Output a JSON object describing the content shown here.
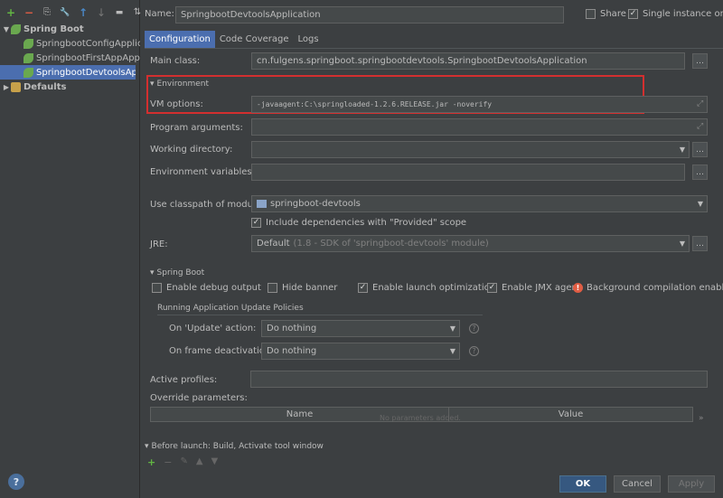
{
  "left_toolbar": {
    "icons": [
      "+",
      "−",
      "⎘",
      "🔧",
      "↑",
      "↓",
      "▬",
      "⇅"
    ]
  },
  "tree": {
    "group_spring_boot": "Spring Boot",
    "items": [
      "SpringbootConfigApplic",
      "SpringbootFirstAppAppl",
      "SpringbootDevtoolsApp"
    ],
    "group_defaults": "Defaults"
  },
  "header": {
    "name_label": "Name:",
    "name_value": "SpringbootDevtoolsApplication",
    "share_label": "Share",
    "single_instance_label": "Single instance only"
  },
  "tabs": [
    "Configuration",
    "Code Coverage",
    "Logs"
  ],
  "form": {
    "main_class_label": "Main class:",
    "main_class_value": "cn.fulgens.springboot.springbootdevtools.SpringbootDevtoolsApplication",
    "environment_section": "Environment",
    "vm_options_label": "VM options:",
    "vm_options_value": "-javaagent:C:\\springloaded-1.2.6.RELEASE.jar -noverify",
    "program_args_label": "Program arguments:",
    "working_dir_label": "Working directory:",
    "env_vars_label": "Environment variables:",
    "classpath_label": "Use classpath of module:",
    "classpath_value": "springboot-devtools",
    "include_deps_label": "Include dependencies with \"Provided\" scope",
    "jre_label": "JRE:",
    "jre_value": "Default",
    "jre_detail": "(1.8 - SDK of 'springboot-devtools' module)"
  },
  "spring_boot": {
    "section": "Spring Boot",
    "debug_output": "Enable debug output",
    "hide_banner": "Hide banner",
    "launch_opt": "Enable launch optimization",
    "jmx_agent": "Enable JMX agent",
    "bg_compilation": "Background compilation enabled",
    "policies_title": "Running Application Update Policies",
    "on_update_label": "On 'Update' action:",
    "on_update_value": "Do nothing",
    "on_frame_label": "On frame deactivation:",
    "on_frame_value": "Do nothing",
    "active_profiles_label": "Active profiles:",
    "override_label": "Override parameters:",
    "col_name": "Name",
    "col_value": "Value",
    "empty_text": "No parameters added."
  },
  "before_launch": {
    "label": "Before launch: Build, Activate tool window"
  },
  "buttons": {
    "ok": "OK",
    "cancel": "Cancel",
    "apply": "Apply"
  },
  "colors": {
    "accent": "#4b6eaf",
    "highlight_box": "#d32f2f"
  }
}
